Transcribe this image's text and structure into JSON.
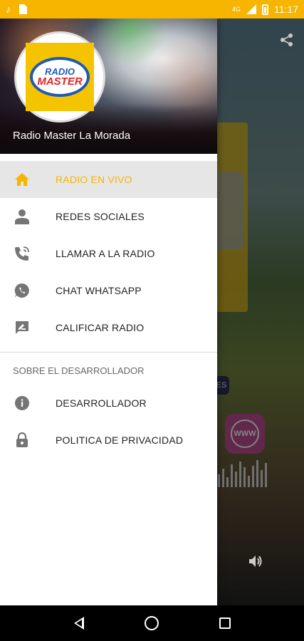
{
  "status_bar": {
    "time": "11:17",
    "network": "4G",
    "icons": [
      "music-note-icon",
      "sim-icon",
      "signal-icon",
      "battery-icon"
    ]
  },
  "drawer": {
    "station_name": "Radio Master La Morada",
    "logo": {
      "line1": "RADIO",
      "line2": "MASTER"
    },
    "items": [
      {
        "label": "RADIO EN VIVO",
        "icon": "home-icon",
        "active": true
      },
      {
        "label": "REDES SOCIALES",
        "icon": "person-icon",
        "active": false
      },
      {
        "label": "LLAMAR A LA RADIO",
        "icon": "phone-in-talk-icon",
        "active": false
      },
      {
        "label": "CHAT WHATSAPP",
        "icon": "whatsapp-icon",
        "active": false
      },
      {
        "label": "CALIFICAR RADIO",
        "icon": "rate-review-icon",
        "active": false
      }
    ],
    "section_title": "SOBRE EL DESARROLLADOR",
    "dev_items": [
      {
        "label": "DESARROLLADOR",
        "icon": "info-icon"
      },
      {
        "label": "POLITICA DE PRIVACIDAD",
        "icon": "lock-icon"
      }
    ]
  },
  "background": {
    "web_button": "WWW"
  },
  "colors": {
    "accent": "#f7b500",
    "active_row": "#e6e6e6",
    "icon_gray": "#757575"
  }
}
